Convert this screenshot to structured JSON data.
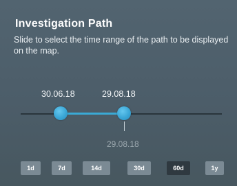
{
  "panel": {
    "title": "Investigation Path",
    "description": "Slide to select the time range of the path to be displayed on the map."
  },
  "slider": {
    "start_label": "30.06.18",
    "end_label": "29.08.18",
    "marker_label": "29.08.18",
    "accent_color": "#3aaad6"
  },
  "range_buttons": [
    {
      "label": "1d",
      "active": false
    },
    {
      "label": "7d",
      "active": false
    },
    {
      "label": "14d",
      "active": false
    },
    {
      "label": "30d",
      "active": false
    },
    {
      "label": "60d",
      "active": true
    },
    {
      "label": "1y",
      "active": false
    }
  ]
}
